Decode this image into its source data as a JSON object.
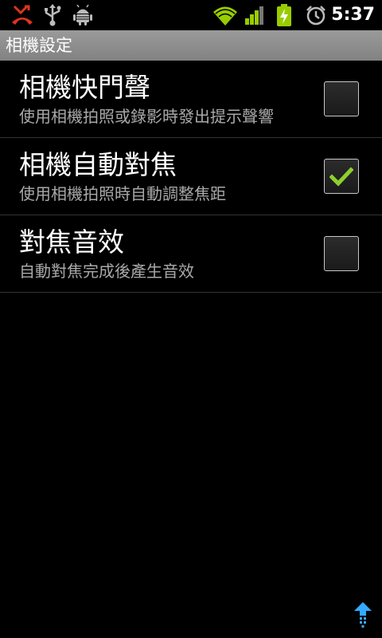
{
  "status_bar": {
    "time": "5:37",
    "icons": [
      "missed-call-icon",
      "usb-icon",
      "android-debug-icon",
      "wifi-icon",
      "signal-icon",
      "battery-charging-icon",
      "alarm-icon"
    ],
    "colors": {
      "missed_call": "#e0331f",
      "wifi": "#99cc00",
      "signal": "#99cc00",
      "battery": "#99cc00"
    }
  },
  "title_bar": {
    "title": "相機設定"
  },
  "settings": [
    {
      "title": "相機快門聲",
      "summary": "使用相機拍照或錄影時發出提示聲響",
      "checked": false
    },
    {
      "title": "相機自動對焦",
      "summary": "使用相機拍照時自動調整焦距",
      "checked": true
    },
    {
      "title": "對焦音效",
      "summary": "自動對焦完成後產生音效",
      "checked": false
    }
  ],
  "check_color": "#8ed02e",
  "accent_color": "#33aaff"
}
